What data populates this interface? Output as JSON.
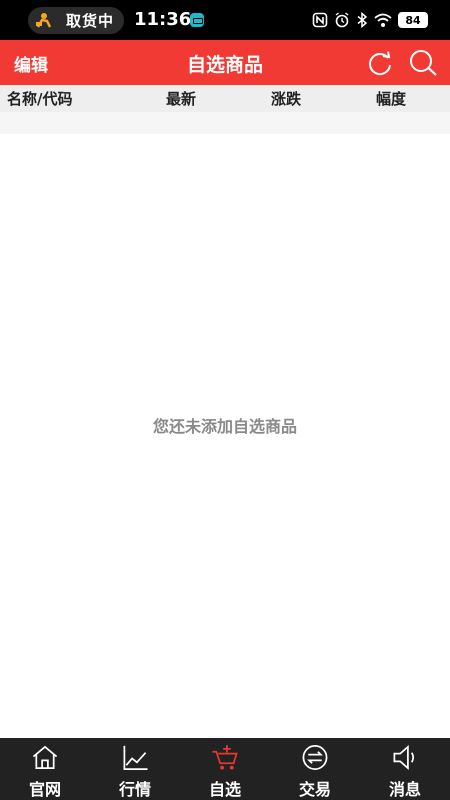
{
  "status_bar": {
    "pill_text": "取货中",
    "time": "11:36",
    "battery": "84",
    "icons": [
      "courier-icon",
      "app-badge-icon",
      "nfc-icon",
      "alarm-icon",
      "bluetooth-icon",
      "wifi-icon",
      "signal-icon",
      "battery-icon"
    ]
  },
  "header": {
    "edit_label": "编辑",
    "title": "自选商品",
    "background": "#f23a35",
    "icons": [
      "refresh-icon",
      "search-icon"
    ]
  },
  "columns": {
    "name": "名称/代码",
    "latest": "最新",
    "change": "涨跌",
    "percent": "幅度"
  },
  "empty_message": "您还未添加自选商品",
  "bottom_nav": {
    "active_color": "#e8382f",
    "items": [
      {
        "label": "官网",
        "icon": "home-icon"
      },
      {
        "label": "行情",
        "icon": "chart-icon"
      },
      {
        "label": "自选",
        "icon": "cart-add-icon",
        "active": true
      },
      {
        "label": "交易",
        "icon": "exchange-icon"
      },
      {
        "label": "消息",
        "icon": "speaker-icon"
      }
    ]
  }
}
